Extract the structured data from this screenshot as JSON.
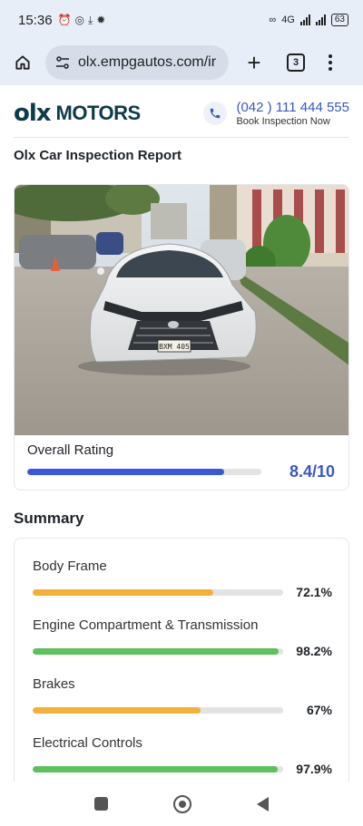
{
  "status_bar": {
    "time": "15:36",
    "network": "4G",
    "battery": "63"
  },
  "browser": {
    "url": "olx.empgautos.com/ir",
    "tab_count": "3"
  },
  "site_header": {
    "logo_mark": "olx",
    "logo_text": "MOTORS",
    "phone": "(042 ) 111 444 555",
    "cta": "Book Inspection Now"
  },
  "report_title": "Olx Car Inspection Report",
  "car": {
    "plate": "BXM 405",
    "rating_label": "Overall Rating",
    "rating_value": "8.4/10",
    "rating_fraction": 0.84
  },
  "summary": {
    "title": "Summary",
    "items": [
      {
        "label": "Body Frame",
        "value": "72.1%",
        "percent": 72.1,
        "color": "#f2b23a"
      },
      {
        "label": "Engine Compartment & Transmission",
        "value": "98.2%",
        "percent": 98.2,
        "color": "#5cc15a"
      },
      {
        "label": "Brakes",
        "value": "67%",
        "percent": 67,
        "color": "#f2b23a"
      },
      {
        "label": "Electrical Controls",
        "value": "97.9%",
        "percent": 97.9,
        "color": "#5cc15a"
      }
    ]
  },
  "colors": {
    "accent": "#3b57c4",
    "brand": "#0d3b4a",
    "good": "#5cc15a",
    "warning": "#f2b23a"
  }
}
